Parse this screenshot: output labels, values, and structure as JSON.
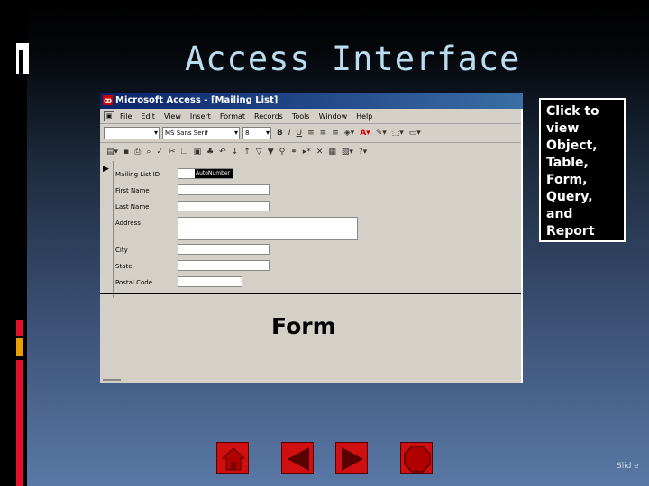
{
  "slide": {
    "title": "Access Interface",
    "slide_number": "Slid e"
  },
  "screenshot": {
    "window_title": "Microsoft Access - [Mailing List]",
    "menu": [
      "File",
      "Edit",
      "View",
      "Insert",
      "Format",
      "Records",
      "Tools",
      "Window",
      "Help"
    ],
    "toolbar": {
      "object_combo": "",
      "font_combo": "MS Sans Serif",
      "size_combo": "8",
      "bold": "B",
      "italic": "I",
      "underline": "U"
    },
    "fields": [
      {
        "label": "Mailing List ID",
        "value": "AutoNumber"
      },
      {
        "label": "First Name",
        "value": ""
      },
      {
        "label": "Last Name",
        "value": ""
      },
      {
        "label": "Address",
        "value": ""
      },
      {
        "label": "City",
        "value": ""
      },
      {
        "label": "State",
        "value": ""
      },
      {
        "label": "Postal Code",
        "value": ""
      }
    ],
    "overlay_label": "Form"
  },
  "callout": {
    "text": "Click to\nview\nObject,\nTable,\nForm,\nQuery,\nand\nReport"
  },
  "nav": {
    "buttons": [
      "home-icon",
      "back-arrow-icon",
      "forward-arrow-icon",
      "stop-icon"
    ],
    "button_color": "#d01010"
  },
  "colors": {
    "title": "#b9dcef",
    "accent": "#e0102a",
    "accent2": "#e8a000"
  }
}
